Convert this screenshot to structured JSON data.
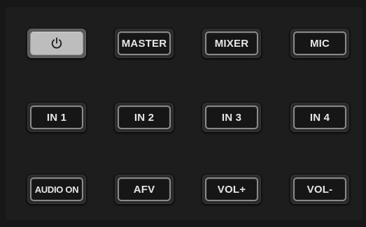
{
  "buttons": {
    "power": {
      "icon": "power-icon"
    },
    "master": "MASTER",
    "mixer": "MIXER",
    "mic": "MIC",
    "in1": "IN 1",
    "in2": "IN 2",
    "in3": "IN 3",
    "in4": "IN 4",
    "audio_on": "AUDIO ON",
    "afv": "AFV",
    "vol_up": "VOL+",
    "vol_down": "VOL-"
  },
  "colors": {
    "panel": "#171717",
    "button_frame": "#2a2a2a",
    "button_face": "#161616",
    "button_ring": "#8a8a8a",
    "label": "#e6e6e6",
    "power_face": "#bdbdbd"
  }
}
